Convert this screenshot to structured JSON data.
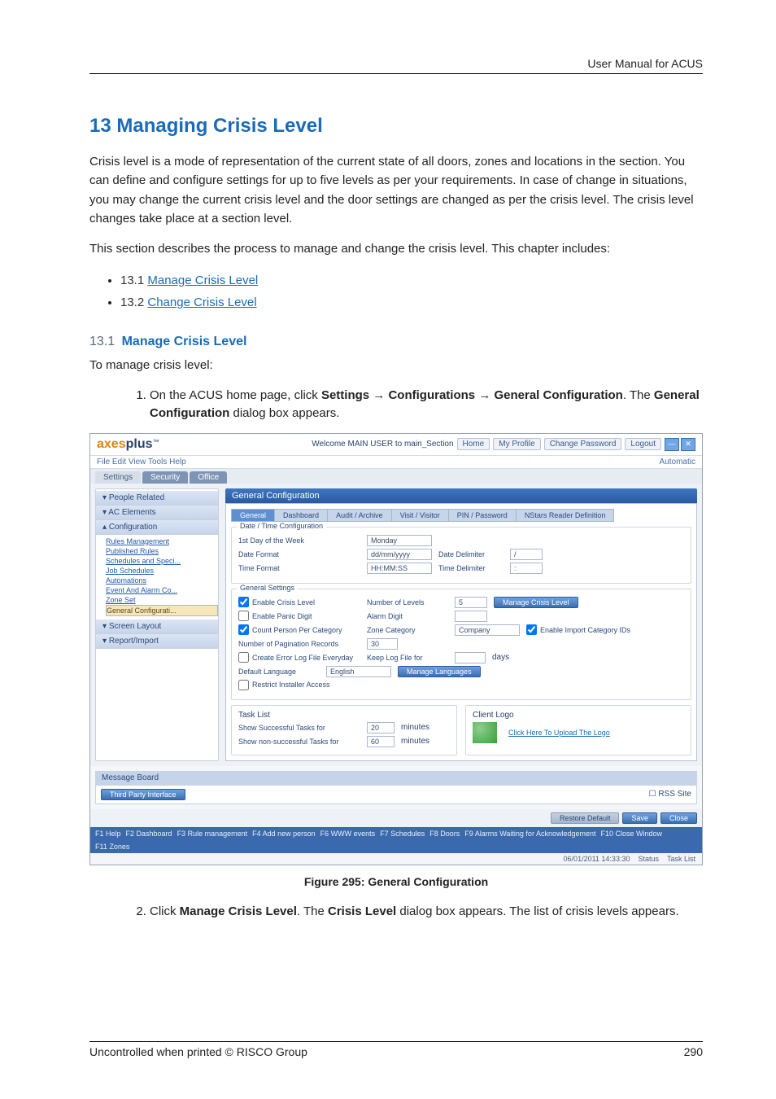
{
  "header": {
    "manual_title": "User Manual for ACUS"
  },
  "section": {
    "h1": "13 Managing Crisis Level",
    "intro1": "Crisis level is a mode of representation of the current state of all doors, zones and locations in the section. You can define and configure settings for up to five levels as per your requirements. In case of change in situations, you may change the current crisis level and the door settings are changed as per the crisis level. The crisis level changes take place at a section level.",
    "intro2": "This section describes the process to manage and change the crisis level. This chapter includes:",
    "toc": [
      {
        "num": "13.1",
        "label": "Manage Crisis Level"
      },
      {
        "num": "13.2",
        "label": "Change Crisis Level"
      }
    ],
    "sub_num": "13.1",
    "sub_title": "Manage Crisis Level",
    "lead": "To manage crisis level:",
    "step1_a": "On the ACUS home page, click ",
    "step1_b": "Settings",
    "step1_c": "Configurations",
    "step1_d": "General Configuration",
    "step1_e": ". The ",
    "step1_f": "General Configuration",
    "step1_g": " dialog box appears.",
    "caption": "Figure 295: General Configuration",
    "step2_a": "Click ",
    "step2_b": "Manage Crisis Level",
    "step2_c": ". The ",
    "step2_d": "Crisis Level",
    "step2_e": " dialog box appears. The list of crisis levels appears."
  },
  "shot": {
    "brand_a": "axes",
    "brand_b": "plus",
    "brand_tm": "™",
    "welcome": "Welcome MAIN USER to main_Section",
    "nav": {
      "home": "Home",
      "profile": "My Profile",
      "changepw": "Change Password",
      "logout": "Logout"
    },
    "menubar": "File  Edit  View  Tools  Help",
    "automatic": "Automatic",
    "toptabs": [
      "Settings",
      "Security",
      "Office"
    ],
    "side_groups": [
      {
        "title": "People Related",
        "chev": "▾",
        "items": []
      },
      {
        "title": "AC Elements",
        "chev": "▾",
        "items": []
      },
      {
        "title": "Configuration",
        "chev": "▴",
        "items": [
          "Rules Management",
          "Published Rules",
          "Schedules and Speci...",
          "Job Schedules",
          "Automations",
          "Event And Alarm Co...",
          "Zone Set",
          "General Configurati..."
        ]
      },
      {
        "title": "Screen Layout",
        "chev": "▾",
        "items": []
      },
      {
        "title": "Report/Import",
        "chev": "▾",
        "items": []
      }
    ],
    "panel_title": "General Configuration",
    "subtabs": [
      "General",
      "Dashboard",
      "Audit / Archive",
      "Visit / Visitor",
      "PIN / Password",
      "NStars Reader Definition"
    ],
    "fs1": {
      "legend": "Date / Time Configuration",
      "r1l": "1st Day of the Week",
      "r1v": "Monday",
      "r2l": "Date Format",
      "r2v": "dd/mm/yyyy",
      "r2l2": "Date Delimiter",
      "r2v2": "/",
      "r3l": "Time Format",
      "r3v": "HH:MM:SS",
      "r3l2": "Time Delimiter",
      "r3v2": ":"
    },
    "fs2": {
      "legend": "General Settings",
      "c1": "Enable Crisis Level",
      "c1l": "Number of Levels",
      "c1v": "5",
      "c1b": "Manage Crisis Level",
      "c2": "Enable Panic Digit",
      "c2l": "Alarm Digit",
      "c3": "Count Person Per Category",
      "c3l": "Zone Category",
      "c3v": "Company",
      "c3r": "Enable Import Category IDs",
      "c4l": "Number of Pagination Records",
      "c4v": "30",
      "c5": "Create Error Log File Everyday",
      "c5l": "Keep Log File for",
      "c5u": "days",
      "c6l": "Default Language",
      "c6v": "English",
      "c6b": "Manage Languages",
      "c7": "Restrict Installer Access"
    },
    "fs3a": {
      "legend": "Task List",
      "r1": "Show Successful Tasks for",
      "r1v": "20",
      "unit": "minutes",
      "r2": "Show non-successful Tasks for",
      "r2v": "60"
    },
    "fs3b": {
      "legend": "Client Logo",
      "link": "Click Here To Upload The Logo"
    },
    "msg": {
      "title": "Message Board",
      "tp": "Third Party Interface",
      "rss": "RSS Site"
    },
    "btns": {
      "restore": "Restore Default",
      "save": "Save",
      "close": "Close"
    },
    "fkeys": [
      "F1 Help",
      "F2 Dashboard",
      "F3 Rule management",
      "F4 Add new person",
      "F6 WWW events",
      "F7 Schedules",
      "F8 Doors",
      "F9 Alarms Waiting for Acknowledgement",
      "F10 Close Window",
      "F11 Zones"
    ],
    "status_ts": "06/01/2011 14:33:30",
    "status_s": "Status",
    "status_t": "Task List"
  },
  "footer": {
    "left": "Uncontrolled when printed © RISCO Group",
    "right": "290"
  }
}
